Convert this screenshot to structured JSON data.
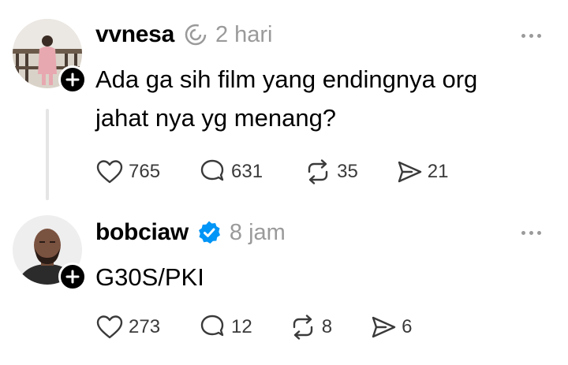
{
  "posts": [
    {
      "username": "vvnesa",
      "time": "2 hari",
      "text_line1": "Ada ga sih film yang endingnya org",
      "text_line2": "jahat nya yg menang?",
      "likes": "765",
      "replies": "631",
      "reposts": "35",
      "shares": "21",
      "badge_icon": "spiral-icon"
    },
    {
      "username": "bobciaw",
      "time": "8 jam",
      "text_line1": "G30S/PKI",
      "likes": "273",
      "replies": "12",
      "reposts": "8",
      "shares": "6",
      "badge_icon": "verified-icon",
      "badge_color": "#0095f6"
    }
  ]
}
